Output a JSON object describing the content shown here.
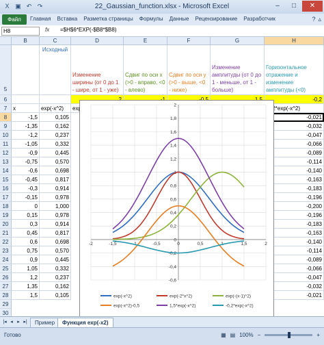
{
  "window": {
    "title": "22_Gaussian_function.xlsx - Microsoft Excel"
  },
  "ribbon": {
    "file_tab": "Файл",
    "tabs": [
      "Главная",
      "Вставка",
      "Разметка страницы",
      "Формулы",
      "Данные",
      "Рецензирование",
      "Разработчик"
    ]
  },
  "formula_bar": {
    "name_box": "H8",
    "fx": "fx",
    "formula": "=$H$6*EXP(-$B8*$B8)"
  },
  "columns": [
    "B",
    "C",
    "D",
    "E",
    "F",
    "G",
    "H"
  ],
  "rows": [
    "5",
    "6",
    "7",
    "8",
    "9",
    "10",
    "11",
    "12",
    "13",
    "14",
    "15",
    "16",
    "17",
    "18",
    "19",
    "20",
    "21",
    "22",
    "23",
    "24",
    "25",
    "26",
    "27",
    "28",
    "29",
    "30",
    "31"
  ],
  "headers_row5": {
    "C": "Исходный",
    "D": "Изменение ширины (от 0 до 1 - шире, от 1 - уже)",
    "E": "Сдвиг по оси х (>0 - вправо, <0 - влево)",
    "F": "Сдвиг по оси у (>0 - выше, <0 - ниже)",
    "G": "Изменение амплитуды (от 0 до 1 - меньше, от 1 - больше)",
    "H": "Горизонтальное отражение и изменение амплитуды (<0)"
  },
  "params_row6": {
    "D": "2",
    "E": "-1",
    "F": "-0,5",
    "G": "1,5",
    "H": "-0,2"
  },
  "labels_row7": {
    "B": "x",
    "C": "exp(-x^2)",
    "D": "exp(-2*x^2)",
    "E": "exp(-(x-1)^2)",
    "F": "exp(-x^2)-0,5",
    "G": "1,5*exp(-x^2)",
    "H": "-0,2*exp(-x^2)"
  },
  "table_x": [
    "-1,5",
    "-1,35",
    "-1,2",
    "-1,05",
    "-0,9",
    "-0,75",
    "-0,6",
    "-0,45",
    "-0,3",
    "-0,15",
    "0",
    "0,15",
    "0,3",
    "0,45",
    "0,6",
    "0,75",
    "0,9",
    "1,05",
    "1,2",
    "1,35",
    "1,5"
  ],
  "table_c": [
    "0,105",
    "0,162",
    "0,237",
    "0,332",
    "0,445",
    "0,570",
    "0,698",
    "0,817",
    "0,914",
    "0,978",
    "1,000",
    "0,978",
    "0,914",
    "0,817",
    "0,698",
    "0,570",
    "0,445",
    "0,332",
    "0,237",
    "0,162",
    "0,105"
  ],
  "table_h": [
    "-0,021",
    "-0,032",
    "-0,047",
    "-0,066",
    "-0,089",
    "-0,114",
    "-0,140",
    "-0,163",
    "-0,183",
    "-0,196",
    "-0,200",
    "-0,196",
    "-0,183",
    "-0,163",
    "-0,140",
    "-0,114",
    "-0,089",
    "-0,066",
    "-0,047",
    "-0,032",
    "-0,021"
  ],
  "sheet_tabs": [
    "Пример",
    "Функция exp(-x2)"
  ],
  "status": {
    "ready": "Готово",
    "zoom": "100%"
  },
  "chart_data": {
    "type": "line",
    "x": [
      -1.5,
      -1.35,
      -1.2,
      -1.05,
      -0.9,
      -0.75,
      -0.6,
      -0.45,
      -0.3,
      -0.15,
      0,
      0.15,
      0.3,
      0.45,
      0.6,
      0.75,
      0.9,
      1.05,
      1.2,
      1.35,
      1.5
    ],
    "xlim": [
      -2,
      2
    ],
    "ylim": [
      -0.6,
      2
    ],
    "x_ticks": [
      "-2",
      "-1,5",
      "-1",
      "-0,5",
      "0",
      "0,5",
      "1",
      "1,5",
      "2"
    ],
    "y_ticks": [
      "-0,6",
      "-0,4",
      "-0,2",
      "0",
      "0,2",
      "0,4",
      "0,6",
      "0,8",
      "1",
      "1,2",
      "1,4",
      "1,6",
      "1,8",
      "2"
    ],
    "grid": true,
    "legend": "bottom",
    "series": [
      {
        "name": "exp(-x^2)",
        "color": "#2e6dbf",
        "values": [
          0.105,
          0.162,
          0.237,
          0.332,
          0.445,
          0.57,
          0.698,
          0.817,
          0.914,
          0.978,
          1.0,
          0.978,
          0.914,
          0.817,
          0.698,
          0.57,
          0.445,
          0.332,
          0.237,
          0.162,
          0.105
        ]
      },
      {
        "name": "exp(-2*x^2)",
        "color": "#c0392b",
        "values": [
          0.011,
          0.026,
          0.056,
          0.11,
          0.198,
          0.325,
          0.487,
          0.667,
          0.835,
          0.956,
          1.0,
          0.956,
          0.835,
          0.667,
          0.487,
          0.325,
          0.198,
          0.11,
          0.056,
          0.026,
          0.011
        ]
      },
      {
        "name": "exp(-(x-1)^2)",
        "color": "#8db33a",
        "values": [
          0.002,
          0.005,
          0.008,
          0.015,
          0.027,
          0.047,
          0.077,
          0.122,
          0.185,
          0.267,
          0.368,
          0.485,
          0.613,
          0.739,
          0.852,
          0.939,
          0.99,
          0.998,
          0.961,
          0.885,
          0.779
        ]
      },
      {
        "name": "1,5*exp(-x^2)",
        "color": "#7d3fa6",
        "values": [
          0.158,
          0.242,
          0.355,
          0.498,
          0.667,
          0.855,
          1.046,
          1.225,
          1.371,
          1.467,
          1.5,
          1.467,
          1.371,
          1.225,
          1.046,
          0.855,
          0.667,
          0.498,
          0.355,
          0.242,
          0.158
        ]
      },
      {
        "name": "exp(-x^2)-0,5",
        "color": "#e67e22",
        "values": [
          -0.395,
          -0.338,
          -0.263,
          -0.168,
          -0.055,
          0.07,
          0.198,
          0.317,
          0.414,
          0.478,
          0.5,
          0.478,
          0.414,
          0.317,
          0.198,
          0.07,
          -0.055,
          -0.168,
          -0.263,
          -0.338,
          -0.395
        ]
      },
      {
        "name": "-0,2*exp(-x^2)",
        "color": "#2a9ab0",
        "values": [
          -0.021,
          -0.032,
          -0.047,
          -0.066,
          -0.089,
          -0.114,
          -0.14,
          -0.163,
          -0.183,
          -0.196,
          -0.2,
          -0.196,
          -0.183,
          -0.163,
          -0.14,
          -0.114,
          -0.089,
          -0.066,
          -0.047,
          -0.032,
          -0.021
        ]
      }
    ]
  }
}
